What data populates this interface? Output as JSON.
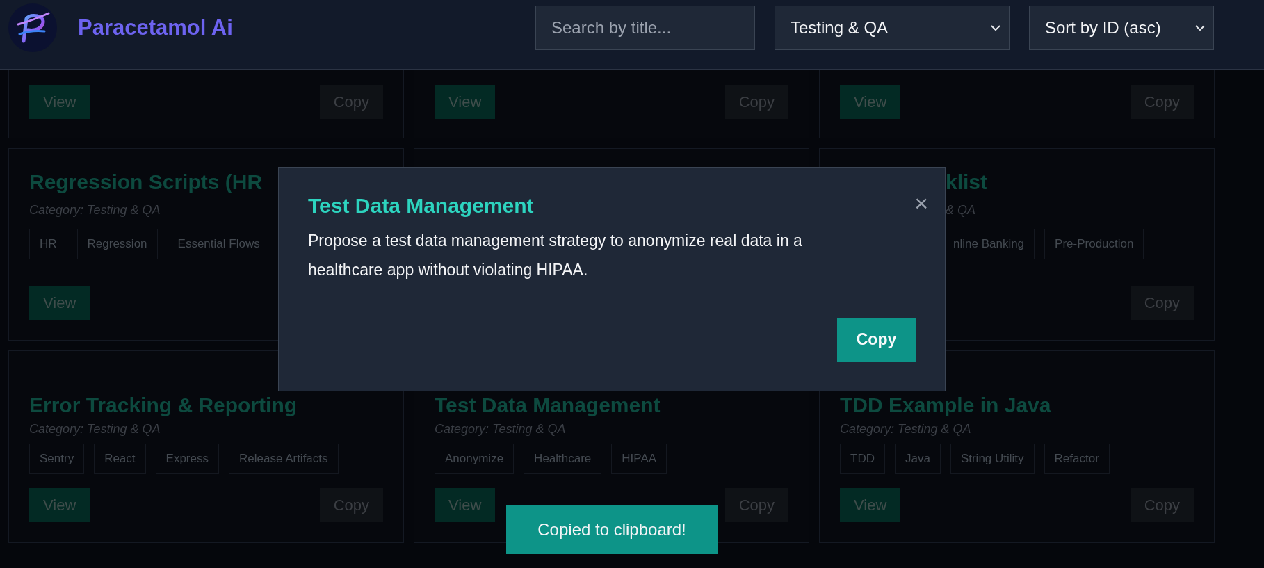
{
  "header": {
    "brand": "Paracetamol Ai",
    "search": {
      "placeholder": "Search by title..."
    },
    "category_select": {
      "value": "Testing & QA"
    },
    "sort_select": {
      "value": "Sort by ID (asc)"
    }
  },
  "cards": [
    {
      "kind": "buttons",
      "view": "View",
      "copy": "Copy"
    },
    {
      "kind": "buttons",
      "view": "View",
      "copy": "Copy"
    },
    {
      "kind": "buttons",
      "view": "View",
      "copy": "Copy"
    },
    {
      "kind": "full",
      "title": "Regression Scripts (HR",
      "category": "Category: Testing & QA",
      "tags": [
        "HR",
        "Regression",
        "Essential Flows"
      ],
      "view": "View"
    },
    {
      "kind": "blank"
    },
    {
      "kind": "right_part",
      "title": "klist",
      "category": "& QA",
      "tags": [
        "nline Banking",
        "Pre-Production"
      ],
      "copy": "Copy"
    },
    {
      "kind": "full",
      "title": "Error Tracking & Reporting",
      "category": "Category: Testing & QA",
      "tags": [
        "Sentry",
        "React",
        "Express",
        "Release Artifacts"
      ],
      "view": "View",
      "copy": "Copy"
    },
    {
      "kind": "full",
      "title": "Test Data Management",
      "category": "Category: Testing & QA",
      "tags": [
        "Anonymize",
        "Healthcare",
        "HIPAA"
      ],
      "view": "View",
      "copy": "Copy"
    },
    {
      "kind": "full",
      "title": "TDD Example in Java",
      "category": "Category: Testing & QA",
      "tags": [
        "TDD",
        "Java",
        "String Utility",
        "Refactor"
      ],
      "view": "View",
      "copy": "Copy"
    }
  ],
  "modal": {
    "title": "Test Data Management",
    "body": "Propose a test data management strategy to anonymize real data in a healthcare app without violating HIPAA.",
    "close": "×",
    "copy": "Copy"
  },
  "toast": {
    "text": "Copied to clipboard!"
  }
}
